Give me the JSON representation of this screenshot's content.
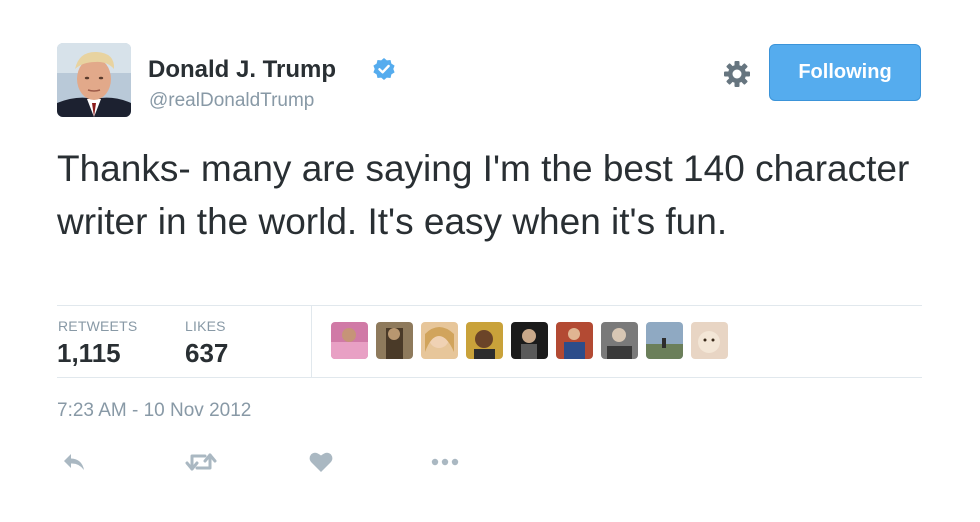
{
  "user": {
    "display_name": "Donald J. Trump",
    "handle": "@realDonaldTrump",
    "verified": true,
    "verified_icon": "verified-badge-icon",
    "avatar_icon": "avatar"
  },
  "header": {
    "settings_icon": "gear-icon",
    "follow_button_label": "Following"
  },
  "tweet": {
    "text": "Thanks- many are saying I'm the best 140 character writer in the world. It's easy when it's fun.",
    "timestamp": "7:23 AM - 10 Nov 2012"
  },
  "stats": {
    "retweets_label": "RETWEETS",
    "retweets_count": "1,115",
    "likes_label": "LIKES",
    "likes_count": "637"
  },
  "likers": [
    {
      "icon": "liker-avatar-1"
    },
    {
      "icon": "liker-avatar-2"
    },
    {
      "icon": "liker-avatar-3"
    },
    {
      "icon": "liker-avatar-4"
    },
    {
      "icon": "liker-avatar-5"
    },
    {
      "icon": "liker-avatar-6"
    },
    {
      "icon": "liker-avatar-7"
    },
    {
      "icon": "liker-avatar-8"
    },
    {
      "icon": "liker-avatar-9"
    }
  ],
  "actions": [
    {
      "icon": "reply-icon"
    },
    {
      "icon": "retweet-icon"
    },
    {
      "icon": "like-heart-icon"
    },
    {
      "icon": "more-options-icon"
    }
  ],
  "colors": {
    "accent": "#55acee",
    "text": "#292f33",
    "muted": "#8899a6",
    "action_icon": "#aab8c2",
    "divider": "#e1e8ed"
  }
}
